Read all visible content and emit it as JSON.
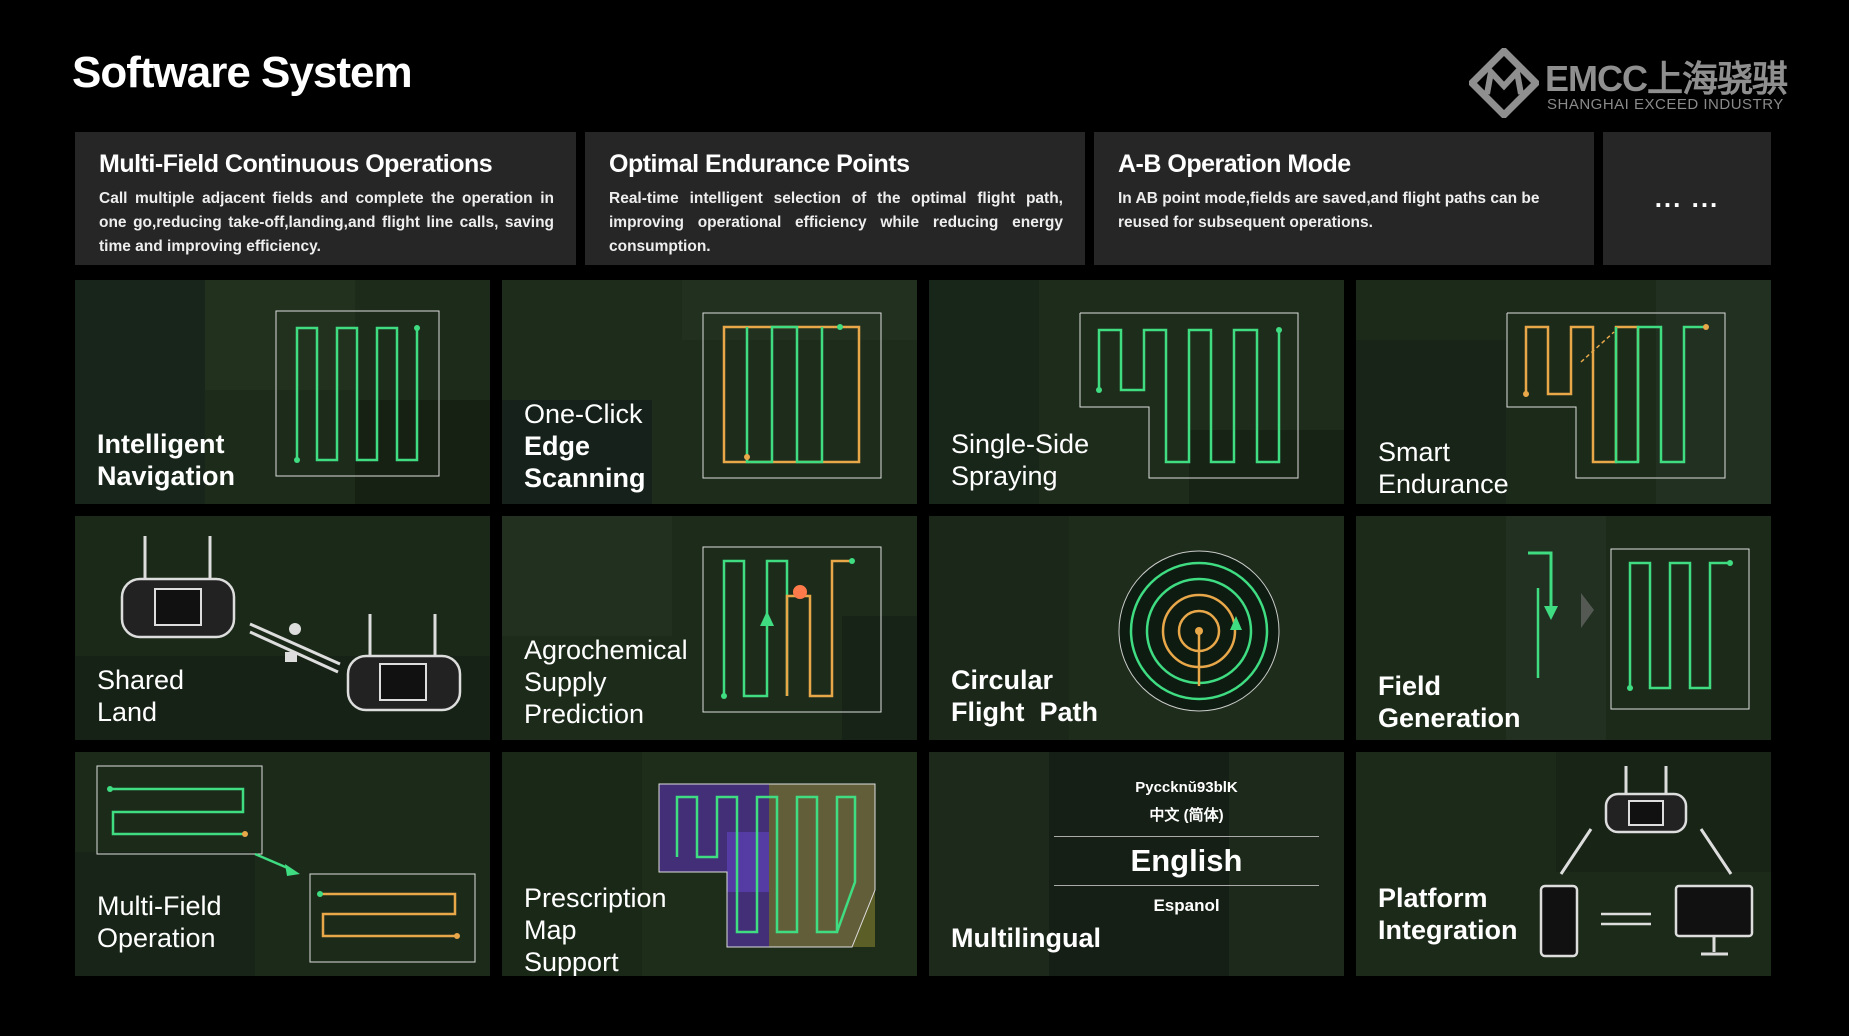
{
  "page": {
    "title": "Software System"
  },
  "logo": {
    "brand": "EMCC上海骁骐",
    "subtitle": "SHANGHAI EXCEED INDUSTRY"
  },
  "features": [
    {
      "title": "Multi-Field Continuous Operations",
      "desc": "Call multiple adjacent fields and complete the operation in one go,reducing take-off,landing,and flight line calls, saving time and improving efficiency."
    },
    {
      "title": "Optimal Endurance Points",
      "desc": "Real-time intelligent selection of the optimal flight path, improving operational efficiency while reducing energy consumption."
    },
    {
      "title": "A-B Operation Mode",
      "desc": "In AB point mode,fields are saved,and flight paths can be reused for subsequent operations."
    }
  ],
  "more": {
    "label": "... ..."
  },
  "tiles": [
    {
      "lines": [
        "Intelligent",
        "Navigation"
      ]
    },
    {
      "lines": [
        "One-Click",
        "Edge",
        "Scanning"
      ]
    },
    {
      "lines": [
        "Single-Side",
        "Spraying"
      ]
    },
    {
      "lines": [
        "Smart",
        "Endurance"
      ]
    },
    {
      "lines": [
        "Shared",
        "Land"
      ]
    },
    {
      "lines": [
        "Agrochemical",
        "Supply",
        "Prediction"
      ]
    },
    {
      "lines": [
        "Circular",
        "Flight  Path"
      ]
    },
    {
      "lines": [
        "Field",
        "Generation"
      ]
    },
    {
      "lines": [
        "Multi-Field",
        "Operation"
      ]
    },
    {
      "lines": [
        "Prescription",
        "Map",
        "Support"
      ]
    },
    {
      "lines": [
        "Multilingual"
      ]
    },
    {
      "lines": [
        "Platform",
        "Integration"
      ]
    }
  ],
  "languages": {
    "items": [
      "Pyccknŭ93blK",
      "中文 (简体)",
      "English",
      "Espanol"
    ],
    "selected": "English"
  },
  "colors": {
    "accent_green": "#3fdc82",
    "accent_orange": "#e8a84a",
    "panel": "#262626"
  }
}
